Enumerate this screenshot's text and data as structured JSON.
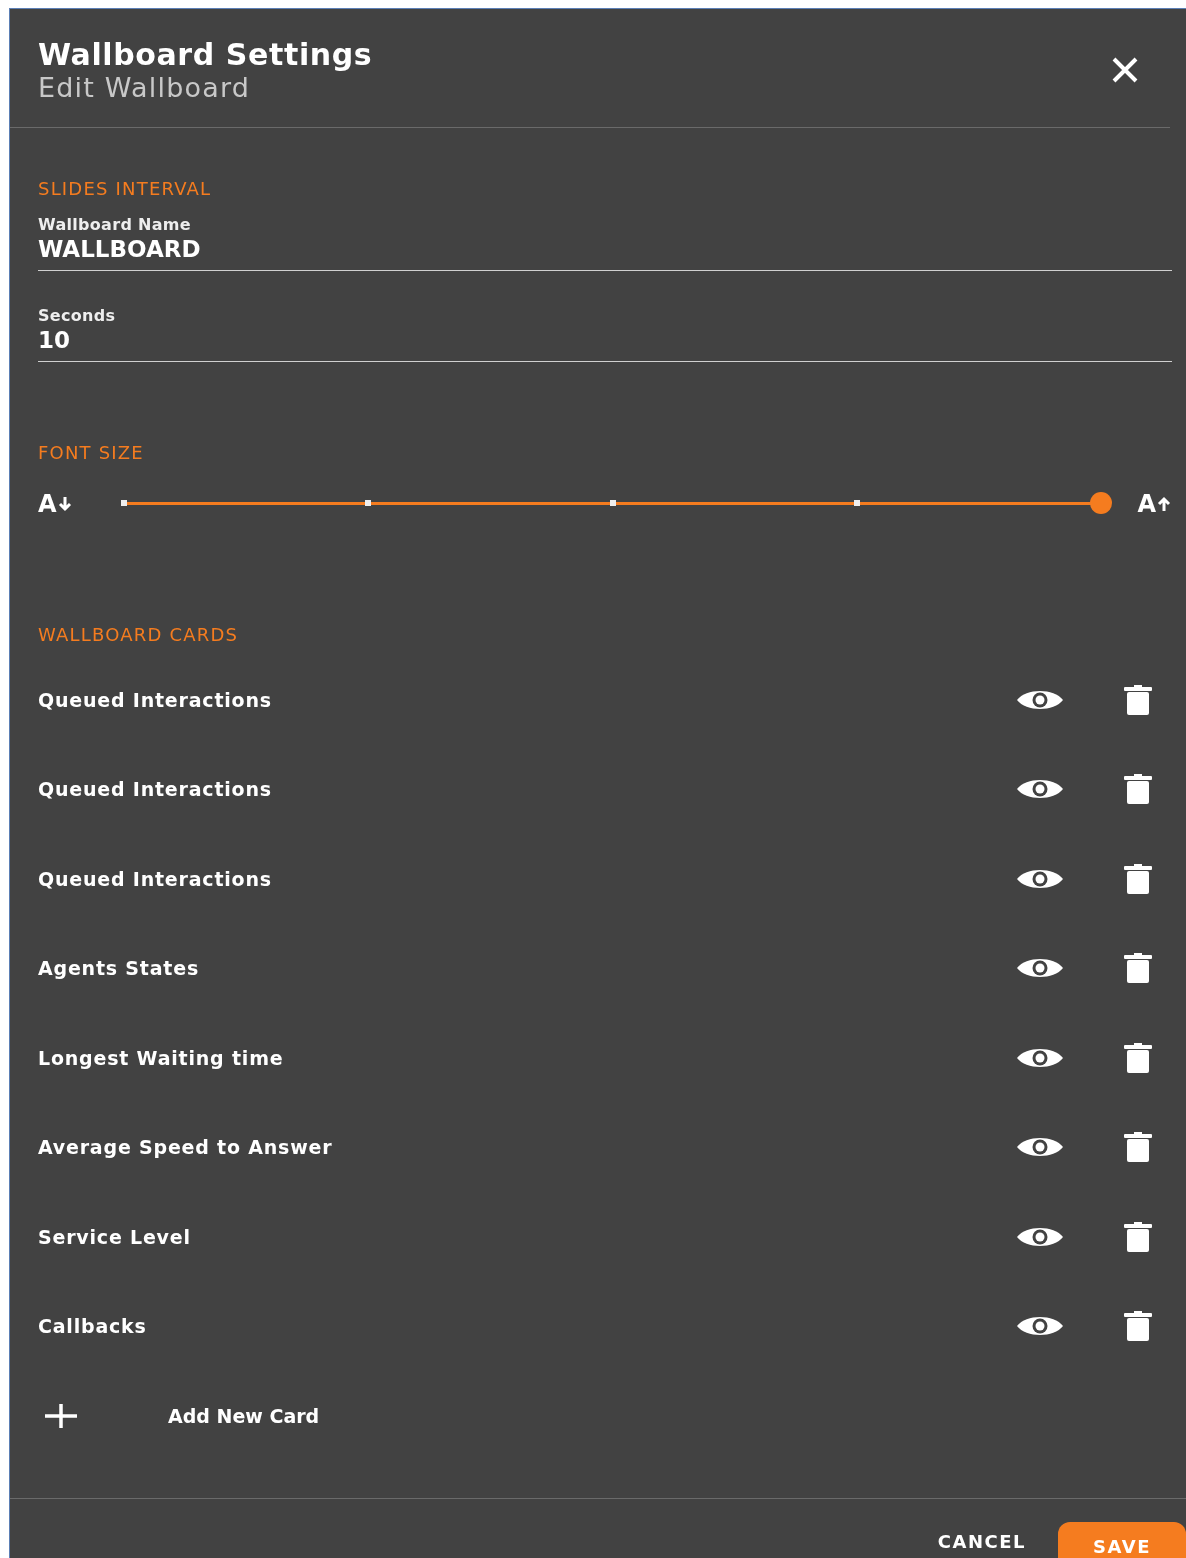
{
  "header": {
    "title": "Wallboard Settings",
    "subtitle": "Edit Wallboard"
  },
  "slides_interval": {
    "heading": "SLIDES INTERVAL",
    "fields": [
      {
        "label": "Wallboard Name",
        "value": "WALLBOARD"
      },
      {
        "label": "Seconds",
        "value": "10"
      }
    ]
  },
  "font_size": {
    "heading": "FONT SIZE",
    "min_label": "A",
    "max_label": "A",
    "level": 1
  },
  "wallboard_cards": {
    "heading": "WALLBOARD CARDS",
    "cards": [
      {
        "name": "Queued Interactions"
      },
      {
        "name": "Queued Interactions"
      },
      {
        "name": "Queued Interactions"
      },
      {
        "name": "Agents States"
      },
      {
        "name": "Longest Waiting time"
      },
      {
        "name": "Average Speed to Answer"
      },
      {
        "name": "Service Level"
      },
      {
        "name": "Callbacks"
      }
    ],
    "add_label": "Add New Card"
  },
  "buttons": [
    {
      "label": "CANCEL",
      "kind": "text"
    },
    {
      "label": "SAVE",
      "kind": "primary"
    }
  ]
}
